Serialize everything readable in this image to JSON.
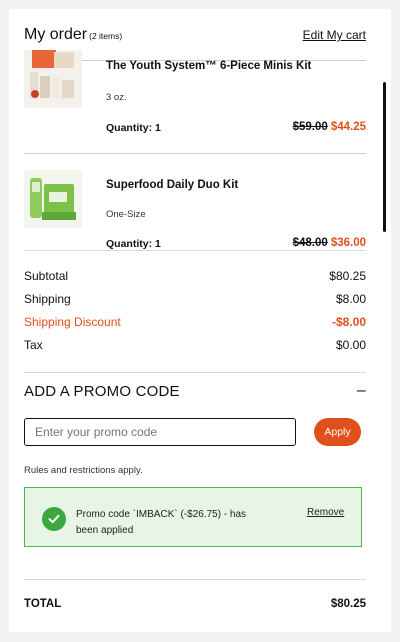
{
  "header": {
    "title": "My order",
    "item_count": "(2 items)",
    "edit_link": "Edit My cart"
  },
  "items": [
    {
      "name": "The Youth System™ 6-Piece Minis Kit",
      "size": "3 oz.",
      "quantity": "Quantity: 1",
      "old_price": "$59.00",
      "new_price": "$44.25",
      "image_icon": "product-thumbnail"
    },
    {
      "name": "Superfood Daily Duo Kit",
      "size": "One-Size",
      "quantity": "Quantity: 1",
      "old_price": "$48.00",
      "new_price": "$36.00",
      "image_icon": "product-thumbnail"
    }
  ],
  "summary": {
    "subtotal_label": "Subtotal",
    "subtotal_value": "$80.25",
    "shipping_label": "Shipping",
    "shipping_value": "$8.00",
    "shipping_discount_label": "Shipping Discount",
    "shipping_discount_value": "-$8.00",
    "tax_label": "Tax",
    "tax_value": "$0.00"
  },
  "promo": {
    "heading": "ADD A PROMO CODE",
    "toggle": "–",
    "placeholder": "Enter your promo code",
    "apply_label": "Apply",
    "rules": "Rules and restrictions apply.",
    "success_message": "Promo code `IMBACK` (-$26.75) - has been applied",
    "remove_label": "Remove"
  },
  "total": {
    "label": "TOTAL",
    "value": "$80.25"
  },
  "colors": {
    "accent": "#e0501b",
    "success_border": "#4cb749",
    "success_bg": "#e7f5e6",
    "check": "#3aa83e"
  }
}
